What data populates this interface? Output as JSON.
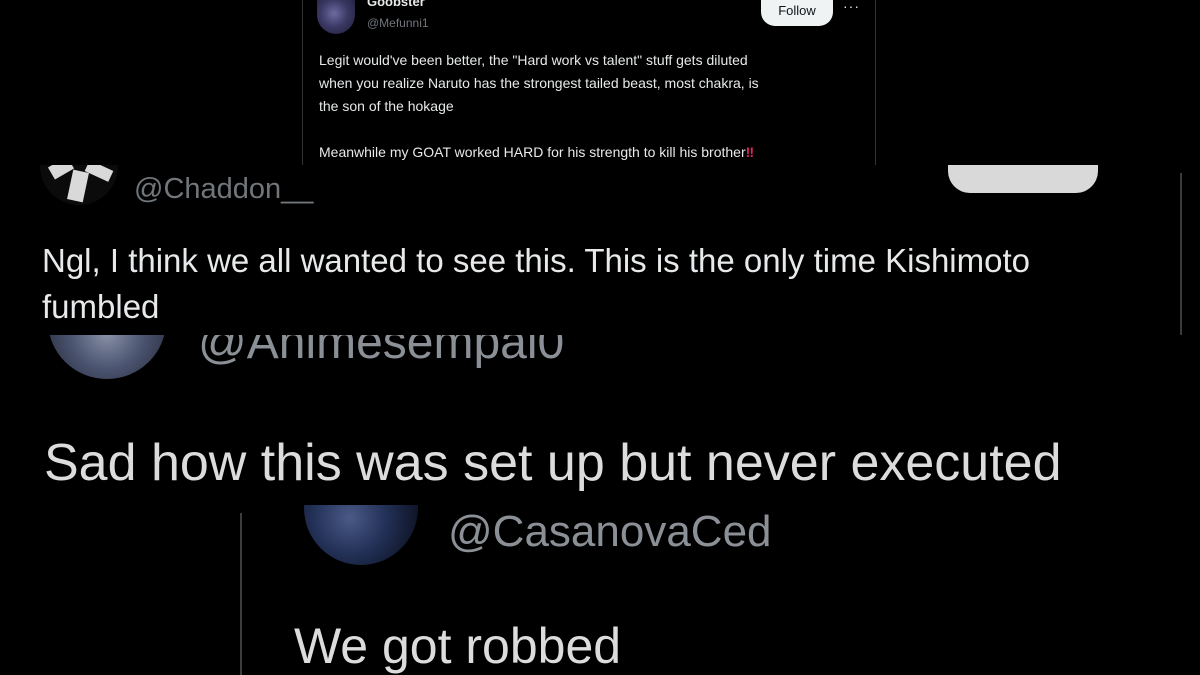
{
  "tweets": [
    {
      "name": "Goobster",
      "handle": "@Mefunni1",
      "follow_label": "Follow",
      "more_label": "···",
      "lines": [
        "Legit would've been better, the \"Hard work vs talent\" stuff gets diluted",
        "when you realize Naruto has the strongest tailed beast, most chakra, is",
        "the son of the hokage",
        "Meanwhile my GOAT worked HARD for his strength to kill his brother"
      ],
      "emoji": "‼"
    },
    {
      "handle": "@Chaddon__",
      "lines": [
        "Ngl, I think we all wanted to see this. This is the only time Kishimoto",
        "fumbled"
      ]
    },
    {
      "handle": "@Animesempai0",
      "lines": [
        "Sad how this was set up but never executed"
      ]
    },
    {
      "handle": "@CasanovaCed",
      "lines": [
        "We got robbed"
      ]
    }
  ],
  "colors": {
    "background": "#000000",
    "text": "#e7e9ea",
    "handle": "#71767b",
    "follow_button": "#eff3f4",
    "emoji_red": "#e0245e"
  }
}
